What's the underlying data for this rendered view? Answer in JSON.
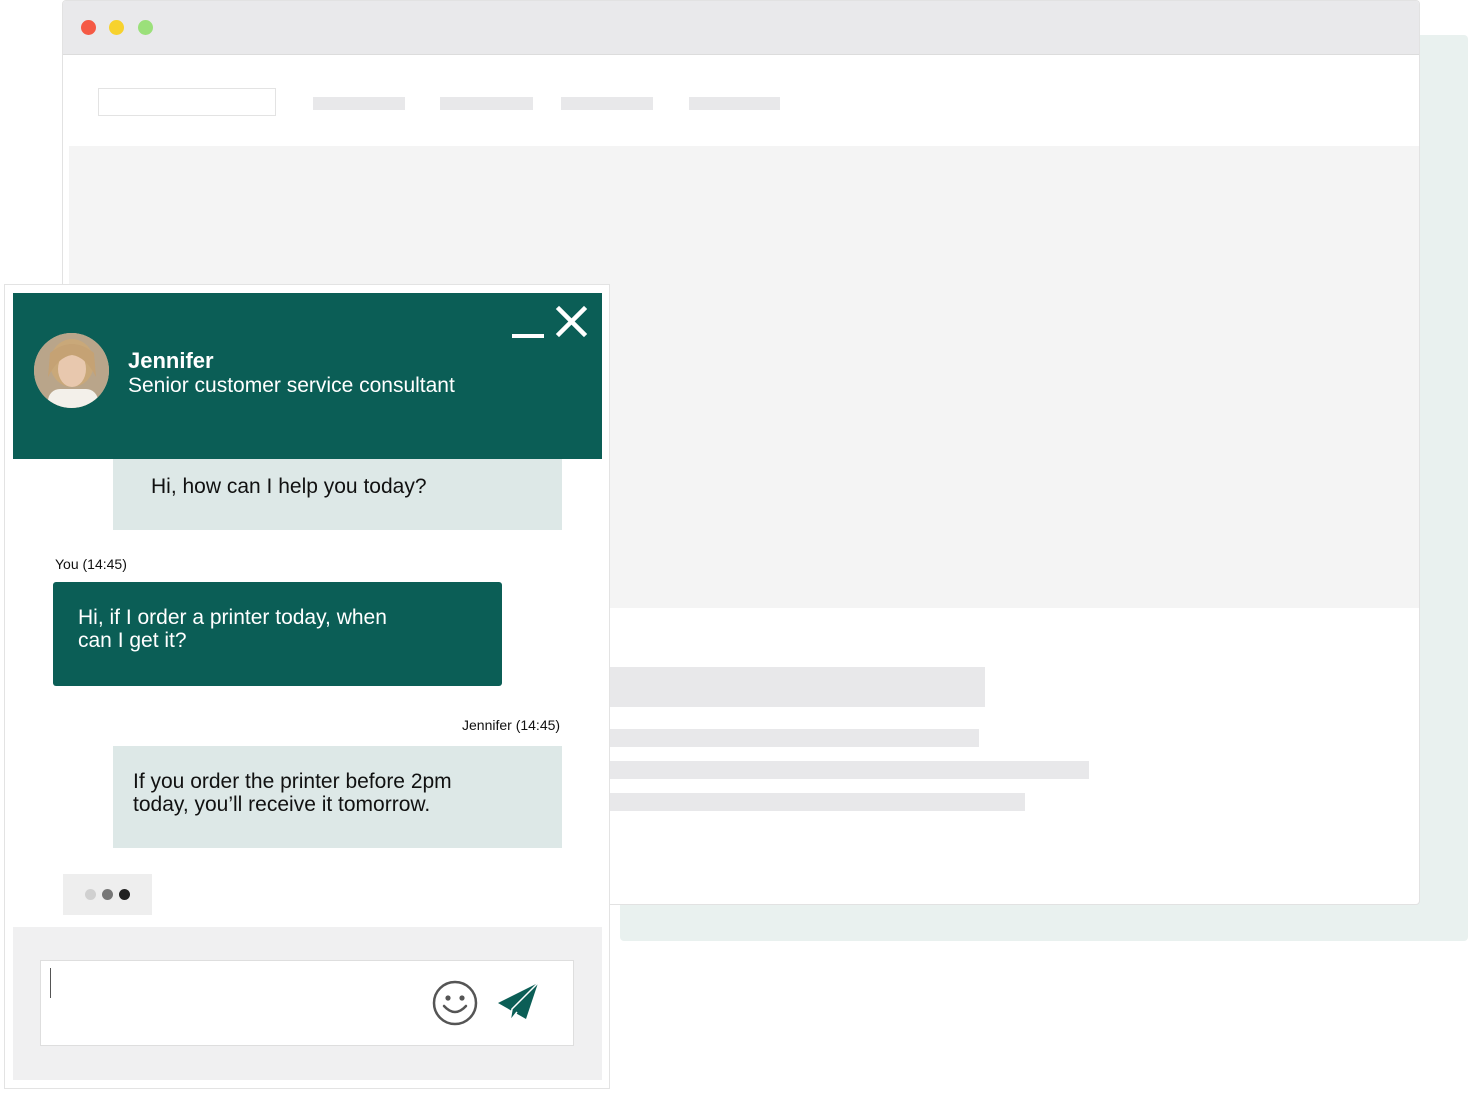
{
  "colors": {
    "brand": "#0b5e56",
    "agent_bubble": "#dde8e7",
    "mac_red": "#f55a45",
    "mac_yellow": "#f7d22e",
    "mac_green": "#9be07a",
    "typing_dot_light": "#d0d0d0",
    "typing_dot_mid": "#777777",
    "typing_dot_dark": "#222222"
  },
  "chat": {
    "agent": {
      "name": "Jennifer",
      "role": "Senior customer service consultant"
    },
    "header_icons": {
      "minimize": "minimize-icon",
      "close": "close-icon"
    },
    "messages": [
      {
        "sender": "agent",
        "text": "Hi, how can I help you today?"
      },
      {
        "sender": "user",
        "meta": "You (14:45)",
        "text": "Hi, if I order a printer today, when can I get it?"
      },
      {
        "sender": "agent",
        "meta": "Jennifer (14:45)",
        "text": "If you order the printer before 2pm today, you’ll receive it tomorrow."
      }
    ],
    "composer": {
      "value": "",
      "emoji_icon": "smiley-icon",
      "send_icon": "paper-plane-icon"
    }
  }
}
